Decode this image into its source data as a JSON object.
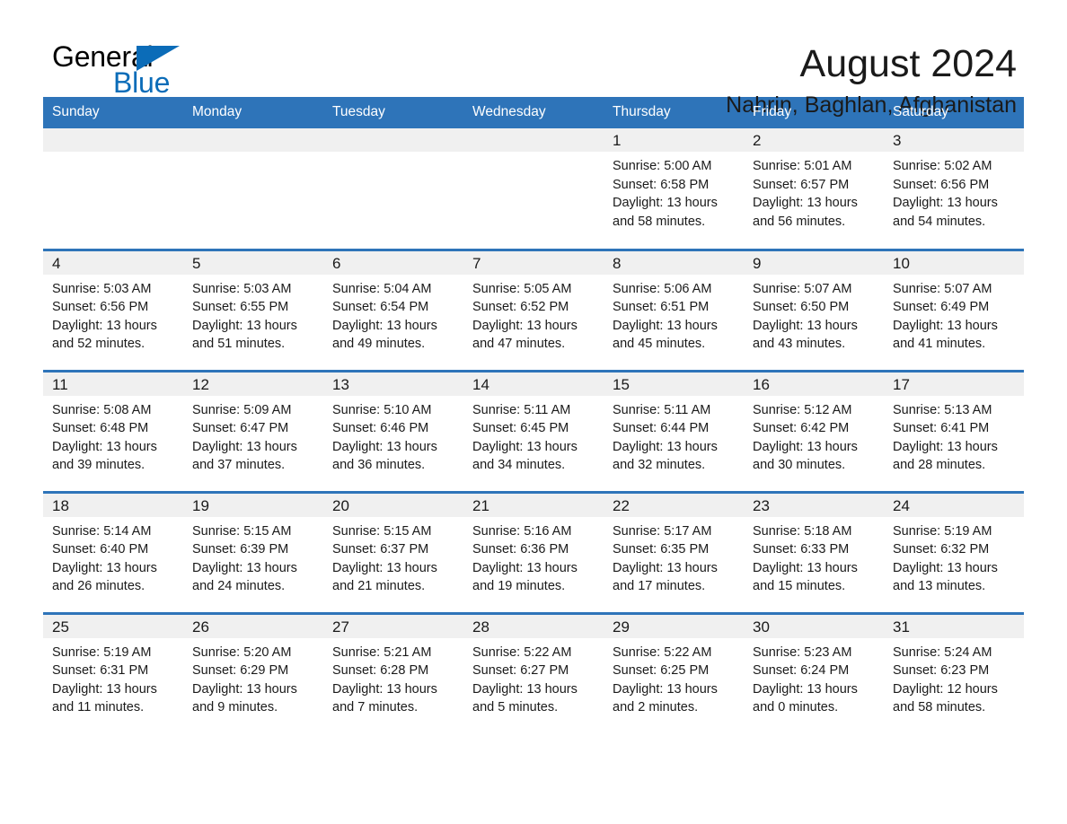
{
  "brand": {
    "name_part1": "General",
    "name_part2": "Blue",
    "accent_color": "#0b6cb8"
  },
  "header": {
    "month_title": "August 2024",
    "location": "Nahrin, Baghlan, Afghanistan"
  },
  "theme": {
    "header_blue": "#2e74b9",
    "daynum_band": "#f0f0f0",
    "text": "#1a1a1a"
  },
  "calendar": {
    "day_headers": [
      "Sunday",
      "Monday",
      "Tuesday",
      "Wednesday",
      "Thursday",
      "Friday",
      "Saturday"
    ],
    "weeks": [
      [
        {
          "day": "",
          "sunrise": "",
          "sunset": "",
          "daylight_line1": "",
          "daylight_line2": "",
          "empty": true
        },
        {
          "day": "",
          "sunrise": "",
          "sunset": "",
          "daylight_line1": "",
          "daylight_line2": "",
          "empty": true
        },
        {
          "day": "",
          "sunrise": "",
          "sunset": "",
          "daylight_line1": "",
          "daylight_line2": "",
          "empty": true
        },
        {
          "day": "",
          "sunrise": "",
          "sunset": "",
          "daylight_line1": "",
          "daylight_line2": "",
          "empty": true
        },
        {
          "day": "1",
          "sunrise": "Sunrise: 5:00 AM",
          "sunset": "Sunset: 6:58 PM",
          "daylight_line1": "Daylight: 13 hours",
          "daylight_line2": "and 58 minutes."
        },
        {
          "day": "2",
          "sunrise": "Sunrise: 5:01 AM",
          "sunset": "Sunset: 6:57 PM",
          "daylight_line1": "Daylight: 13 hours",
          "daylight_line2": "and 56 minutes."
        },
        {
          "day": "3",
          "sunrise": "Sunrise: 5:02 AM",
          "sunset": "Sunset: 6:56 PM",
          "daylight_line1": "Daylight: 13 hours",
          "daylight_line2": "and 54 minutes."
        }
      ],
      [
        {
          "day": "4",
          "sunrise": "Sunrise: 5:03 AM",
          "sunset": "Sunset: 6:56 PM",
          "daylight_line1": "Daylight: 13 hours",
          "daylight_line2": "and 52 minutes."
        },
        {
          "day": "5",
          "sunrise": "Sunrise: 5:03 AM",
          "sunset": "Sunset: 6:55 PM",
          "daylight_line1": "Daylight: 13 hours",
          "daylight_line2": "and 51 minutes."
        },
        {
          "day": "6",
          "sunrise": "Sunrise: 5:04 AM",
          "sunset": "Sunset: 6:54 PM",
          "daylight_line1": "Daylight: 13 hours",
          "daylight_line2": "and 49 minutes."
        },
        {
          "day": "7",
          "sunrise": "Sunrise: 5:05 AM",
          "sunset": "Sunset: 6:52 PM",
          "daylight_line1": "Daylight: 13 hours",
          "daylight_line2": "and 47 minutes."
        },
        {
          "day": "8",
          "sunrise": "Sunrise: 5:06 AM",
          "sunset": "Sunset: 6:51 PM",
          "daylight_line1": "Daylight: 13 hours",
          "daylight_line2": "and 45 minutes."
        },
        {
          "day": "9",
          "sunrise": "Sunrise: 5:07 AM",
          "sunset": "Sunset: 6:50 PM",
          "daylight_line1": "Daylight: 13 hours",
          "daylight_line2": "and 43 minutes."
        },
        {
          "day": "10",
          "sunrise": "Sunrise: 5:07 AM",
          "sunset": "Sunset: 6:49 PM",
          "daylight_line1": "Daylight: 13 hours",
          "daylight_line2": "and 41 minutes."
        }
      ],
      [
        {
          "day": "11",
          "sunrise": "Sunrise: 5:08 AM",
          "sunset": "Sunset: 6:48 PM",
          "daylight_line1": "Daylight: 13 hours",
          "daylight_line2": "and 39 minutes."
        },
        {
          "day": "12",
          "sunrise": "Sunrise: 5:09 AM",
          "sunset": "Sunset: 6:47 PM",
          "daylight_line1": "Daylight: 13 hours",
          "daylight_line2": "and 37 minutes."
        },
        {
          "day": "13",
          "sunrise": "Sunrise: 5:10 AM",
          "sunset": "Sunset: 6:46 PM",
          "daylight_line1": "Daylight: 13 hours",
          "daylight_line2": "and 36 minutes."
        },
        {
          "day": "14",
          "sunrise": "Sunrise: 5:11 AM",
          "sunset": "Sunset: 6:45 PM",
          "daylight_line1": "Daylight: 13 hours",
          "daylight_line2": "and 34 minutes."
        },
        {
          "day": "15",
          "sunrise": "Sunrise: 5:11 AM",
          "sunset": "Sunset: 6:44 PM",
          "daylight_line1": "Daylight: 13 hours",
          "daylight_line2": "and 32 minutes."
        },
        {
          "day": "16",
          "sunrise": "Sunrise: 5:12 AM",
          "sunset": "Sunset: 6:42 PM",
          "daylight_line1": "Daylight: 13 hours",
          "daylight_line2": "and 30 minutes."
        },
        {
          "day": "17",
          "sunrise": "Sunrise: 5:13 AM",
          "sunset": "Sunset: 6:41 PM",
          "daylight_line1": "Daylight: 13 hours",
          "daylight_line2": "and 28 minutes."
        }
      ],
      [
        {
          "day": "18",
          "sunrise": "Sunrise: 5:14 AM",
          "sunset": "Sunset: 6:40 PM",
          "daylight_line1": "Daylight: 13 hours",
          "daylight_line2": "and 26 minutes."
        },
        {
          "day": "19",
          "sunrise": "Sunrise: 5:15 AM",
          "sunset": "Sunset: 6:39 PM",
          "daylight_line1": "Daylight: 13 hours",
          "daylight_line2": "and 24 minutes."
        },
        {
          "day": "20",
          "sunrise": "Sunrise: 5:15 AM",
          "sunset": "Sunset: 6:37 PM",
          "daylight_line1": "Daylight: 13 hours",
          "daylight_line2": "and 21 minutes."
        },
        {
          "day": "21",
          "sunrise": "Sunrise: 5:16 AM",
          "sunset": "Sunset: 6:36 PM",
          "daylight_line1": "Daylight: 13 hours",
          "daylight_line2": "and 19 minutes."
        },
        {
          "day": "22",
          "sunrise": "Sunrise: 5:17 AM",
          "sunset": "Sunset: 6:35 PM",
          "daylight_line1": "Daylight: 13 hours",
          "daylight_line2": "and 17 minutes."
        },
        {
          "day": "23",
          "sunrise": "Sunrise: 5:18 AM",
          "sunset": "Sunset: 6:33 PM",
          "daylight_line1": "Daylight: 13 hours",
          "daylight_line2": "and 15 minutes."
        },
        {
          "day": "24",
          "sunrise": "Sunrise: 5:19 AM",
          "sunset": "Sunset: 6:32 PM",
          "daylight_line1": "Daylight: 13 hours",
          "daylight_line2": "and 13 minutes."
        }
      ],
      [
        {
          "day": "25",
          "sunrise": "Sunrise: 5:19 AM",
          "sunset": "Sunset: 6:31 PM",
          "daylight_line1": "Daylight: 13 hours",
          "daylight_line2": "and 11 minutes."
        },
        {
          "day": "26",
          "sunrise": "Sunrise: 5:20 AM",
          "sunset": "Sunset: 6:29 PM",
          "daylight_line1": "Daylight: 13 hours",
          "daylight_line2": "and 9 minutes."
        },
        {
          "day": "27",
          "sunrise": "Sunrise: 5:21 AM",
          "sunset": "Sunset: 6:28 PM",
          "daylight_line1": "Daylight: 13 hours",
          "daylight_line2": "and 7 minutes."
        },
        {
          "day": "28",
          "sunrise": "Sunrise: 5:22 AM",
          "sunset": "Sunset: 6:27 PM",
          "daylight_line1": "Daylight: 13 hours",
          "daylight_line2": "and 5 minutes."
        },
        {
          "day": "29",
          "sunrise": "Sunrise: 5:22 AM",
          "sunset": "Sunset: 6:25 PM",
          "daylight_line1": "Daylight: 13 hours",
          "daylight_line2": "and 2 minutes."
        },
        {
          "day": "30",
          "sunrise": "Sunrise: 5:23 AM",
          "sunset": "Sunset: 6:24 PM",
          "daylight_line1": "Daylight: 13 hours",
          "daylight_line2": "and 0 minutes."
        },
        {
          "day": "31",
          "sunrise": "Sunrise: 5:24 AM",
          "sunset": "Sunset: 6:23 PM",
          "daylight_line1": "Daylight: 12 hours",
          "daylight_line2": "and 58 minutes."
        }
      ]
    ]
  }
}
